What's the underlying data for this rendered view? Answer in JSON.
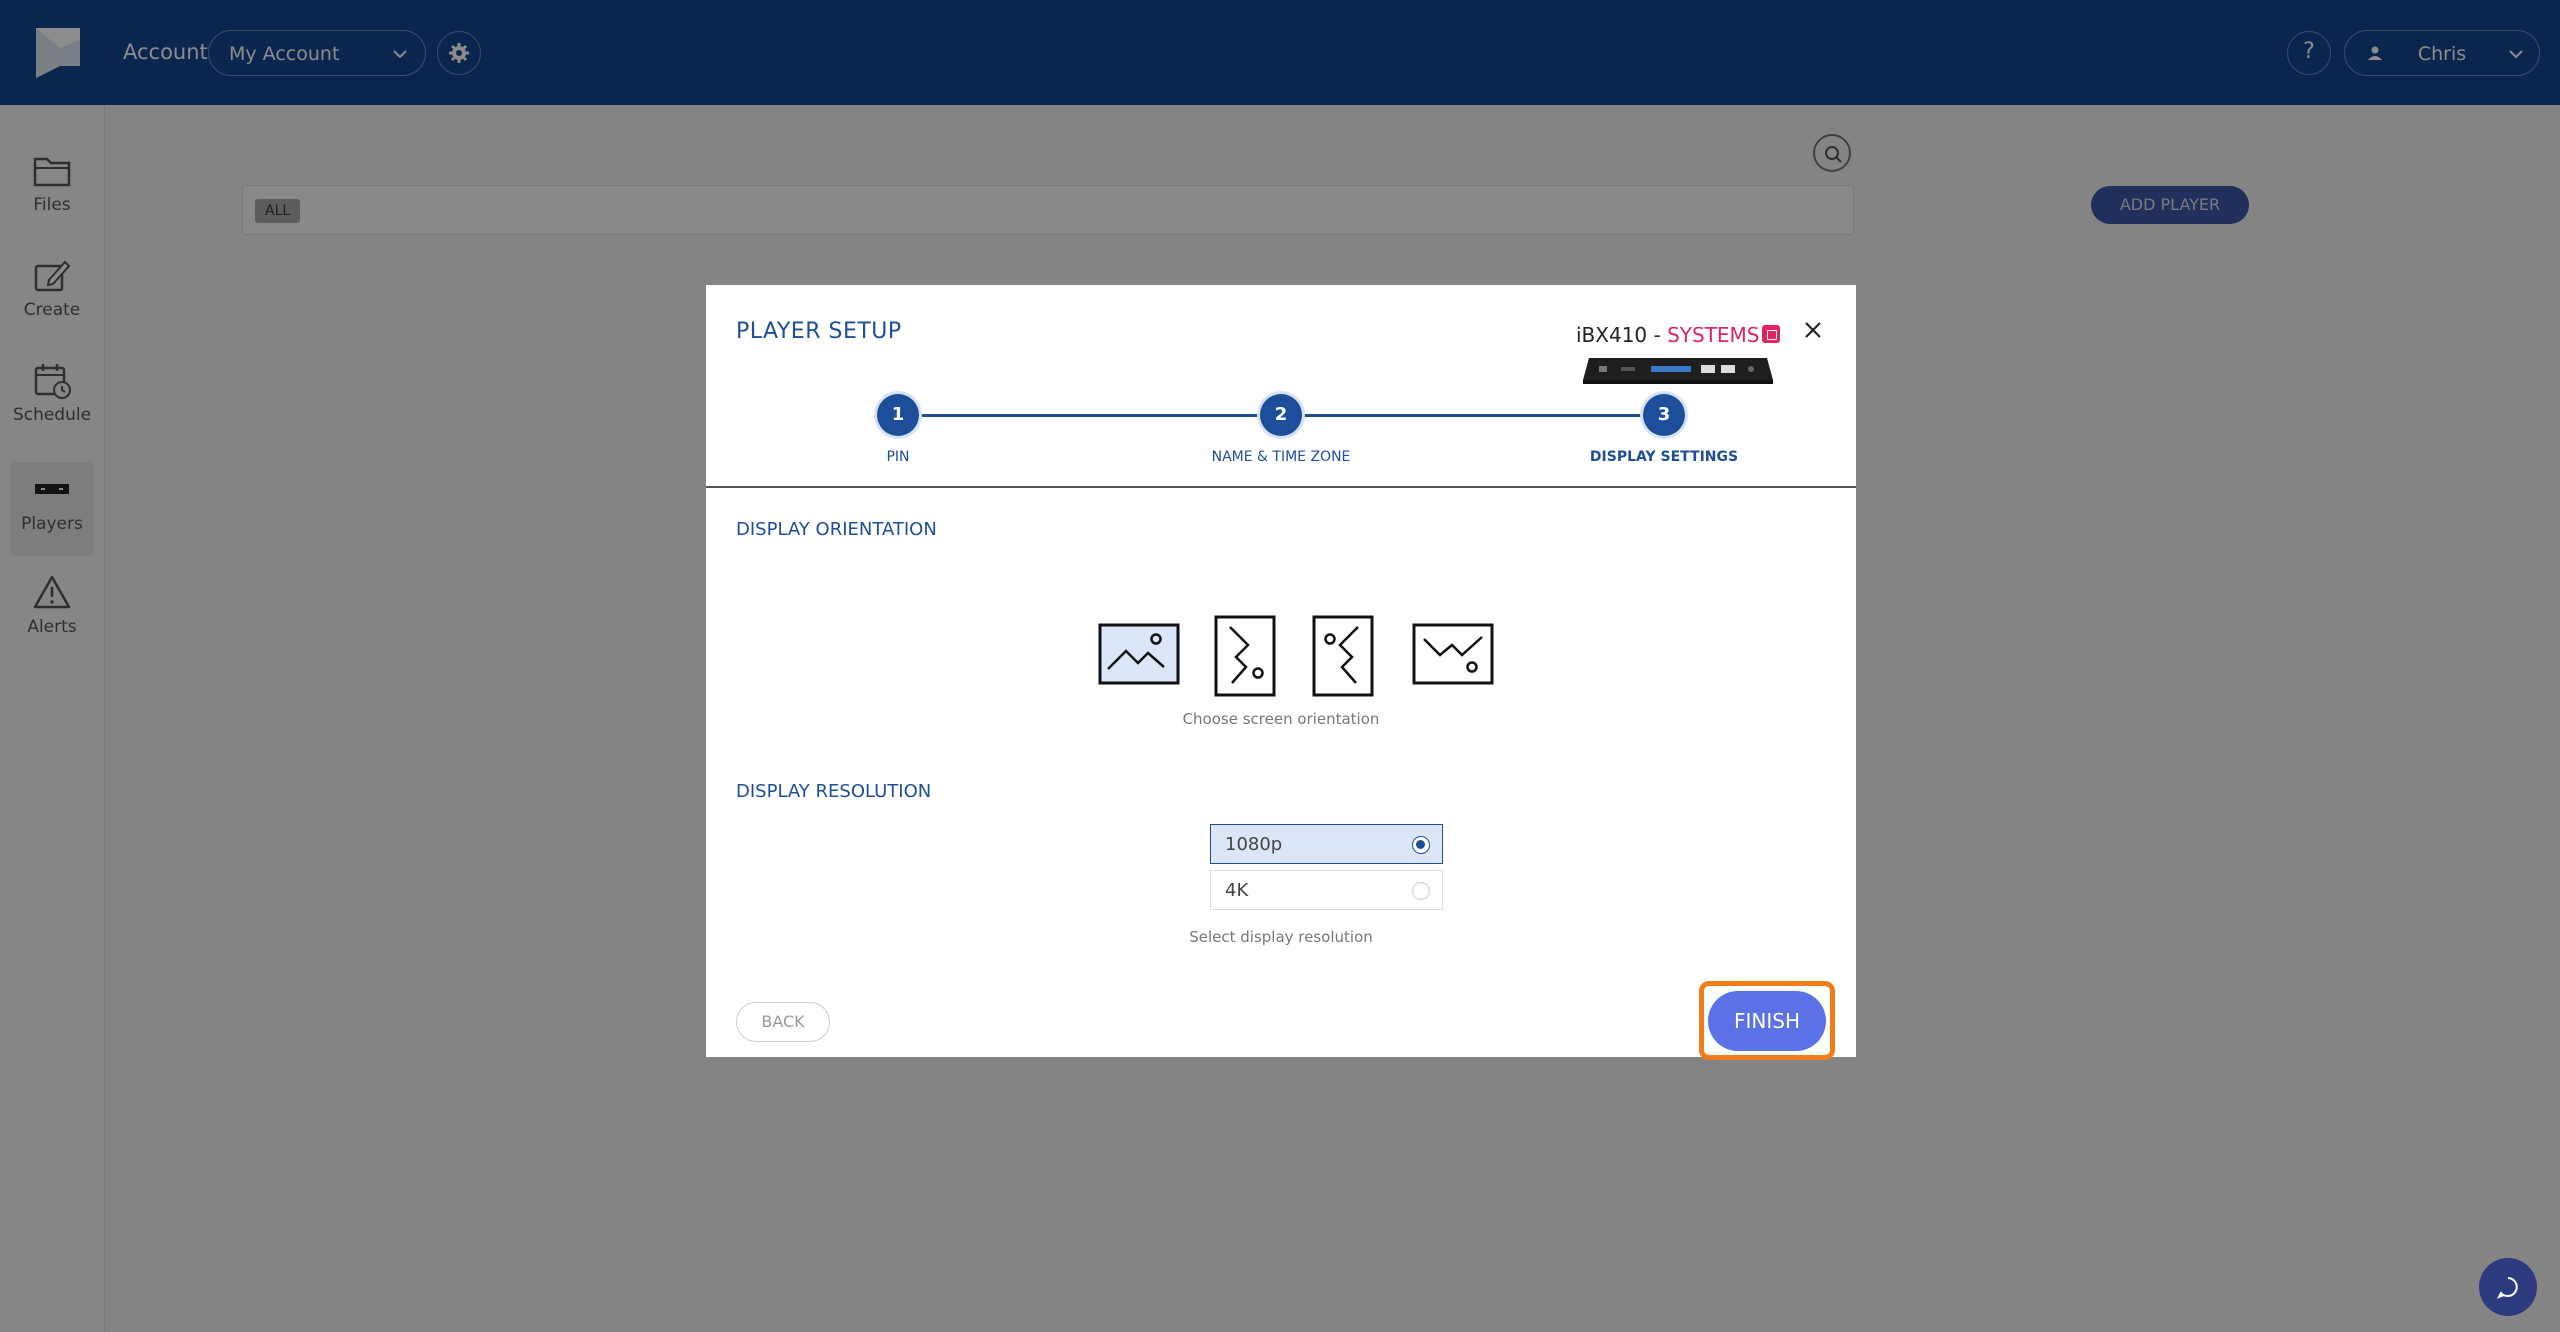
{
  "header": {
    "account_label": "Account",
    "account_value": "My Account",
    "help_label": "?",
    "user_name": "Chris"
  },
  "sidebar": {
    "items": [
      {
        "label": "Files",
        "icon": "folder-icon"
      },
      {
        "label": "Create",
        "icon": "edit-icon"
      },
      {
        "label": "Schedule",
        "icon": "calendar-icon"
      },
      {
        "label": "Players",
        "icon": "player-device-icon",
        "active": true
      },
      {
        "label": "Alerts",
        "icon": "warning-icon"
      }
    ]
  },
  "page": {
    "filter_chip": "ALL",
    "add_player_label": "ADD PLAYER"
  },
  "modal": {
    "title": "PLAYER SETUP",
    "device_model": "iBX410 - ",
    "device_brand": "SYSTEMS",
    "steps": [
      {
        "number": "1",
        "label": "PIN"
      },
      {
        "number": "2",
        "label": "NAME & TIME ZONE"
      },
      {
        "number": "3",
        "label": "DISPLAY SETTINGS",
        "current": true
      }
    ],
    "orientation": {
      "title": "DISPLAY ORIENTATION",
      "caption": "Choose screen orientation",
      "options": [
        "landscape-icon",
        "portrait-right-icon",
        "portrait-left-icon",
        "landscape-flipped-icon"
      ]
    },
    "resolution": {
      "title": "DISPLAY RESOLUTION",
      "caption": "Select display resolution",
      "options": [
        {
          "label": "1080p",
          "selected": true
        },
        {
          "label": "4K",
          "selected": false
        }
      ]
    },
    "back_label": "BACK",
    "finish_label": "FINISH"
  },
  "colors": {
    "header_bg": "#13458f",
    "accent": "#1d4e9a",
    "finish_bg": "#5b72e6",
    "highlight": "#f07d1a",
    "brand_red": "#e0245e"
  }
}
